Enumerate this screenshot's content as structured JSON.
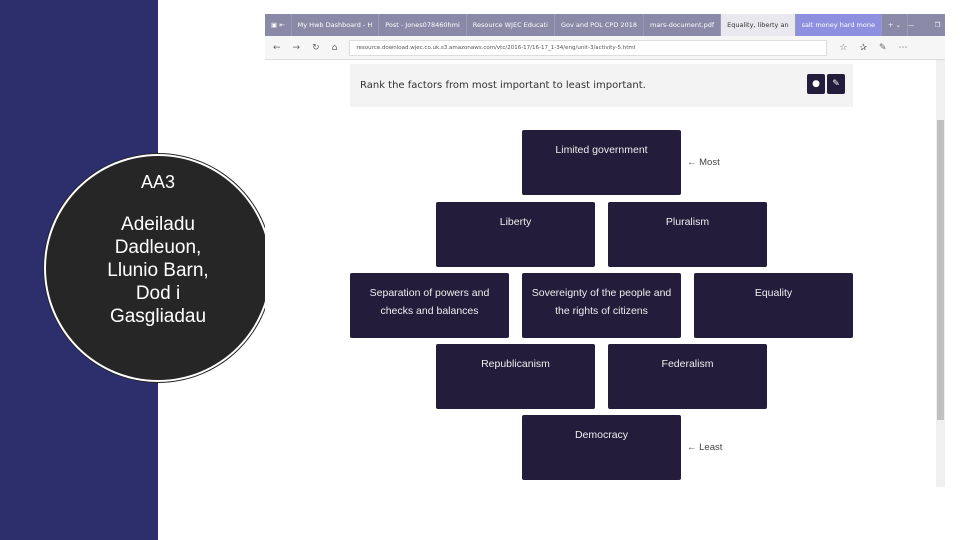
{
  "slide": {
    "circle_title": "AA3",
    "circle_text": "Adeiladu Dadleuon, Llunio Barn, Dod i Gasgliadau",
    "panel_color": "#2c2f6b"
  },
  "browser": {
    "tabs": [
      "My Hwb Dashboard - H",
      "Post - Jones078460hmi",
      "Resource WJEC Educati",
      "Gov and POL CPD 2018",
      "mars-document.pdf",
      "Equality, liberty an",
      "salt money hard mone"
    ],
    "active_tab": 5,
    "url": "resource.download.wjec.co.uk.s3.amazonaws.com/vtc/2016-17/16-17_1-34/eng/unit-3/activity-5.html"
  },
  "activity": {
    "prompt": "Rank the factors from most important to least important.",
    "factors": [
      "Limited government",
      "Liberty",
      "Pluralism",
      "Separation of powers and checks and balances",
      "Sovereignty of the people and the rights of citizens",
      "Equality",
      "Republicanism",
      "Federalism",
      "Democracy"
    ],
    "most_label": "← Most",
    "least_label": "← Least",
    "box_color": "#231c3a"
  }
}
